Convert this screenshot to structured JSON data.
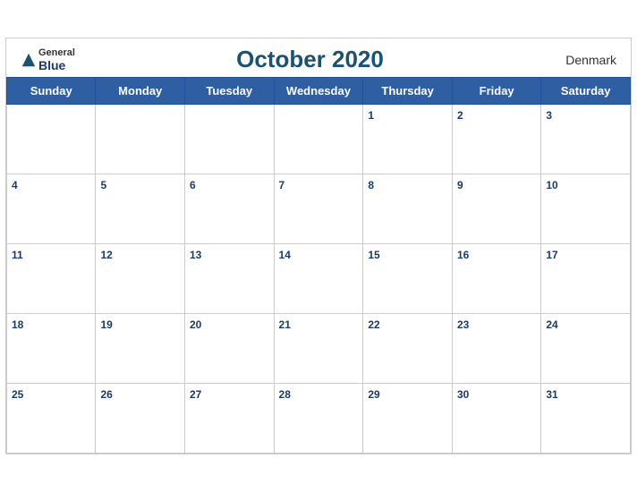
{
  "header": {
    "logo_general": "General",
    "logo_blue": "Blue",
    "month_title": "October 2020",
    "country": "Denmark"
  },
  "days_of_week": [
    "Sunday",
    "Monday",
    "Tuesday",
    "Wednesday",
    "Thursday",
    "Friday",
    "Saturday"
  ],
  "weeks": [
    [
      null,
      null,
      null,
      null,
      1,
      2,
      3
    ],
    [
      4,
      5,
      6,
      7,
      8,
      9,
      10
    ],
    [
      11,
      12,
      13,
      14,
      15,
      16,
      17
    ],
    [
      18,
      19,
      20,
      21,
      22,
      23,
      24
    ],
    [
      25,
      26,
      27,
      28,
      29,
      30,
      31
    ]
  ]
}
